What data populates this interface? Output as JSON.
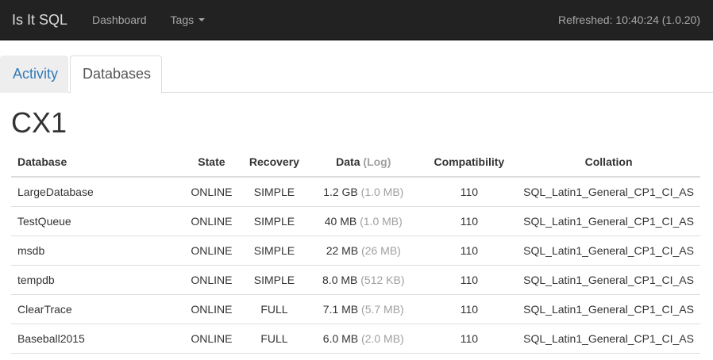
{
  "navbar": {
    "brand": "Is It SQL",
    "links": [
      {
        "label": "Dashboard"
      },
      {
        "label": "Tags"
      }
    ],
    "refreshed": "Refreshed: 10:40:24 (1.0.20)"
  },
  "tabs": [
    {
      "label": "Activity",
      "active": false
    },
    {
      "label": "Databases",
      "active": true
    }
  ],
  "server": {
    "name": "CX1"
  },
  "table": {
    "headers": {
      "database": "Database",
      "state": "State",
      "recovery": "Recovery",
      "data": "Data",
      "log": "(Log)",
      "compatibility": "Compatibility",
      "collation": "Collation"
    },
    "rows": [
      {
        "database": "LargeDatabase",
        "state": "ONLINE",
        "recovery": "SIMPLE",
        "data": "1.2 GB",
        "log": "(1.0 MB)",
        "compatibility": "110",
        "collation": "SQL_Latin1_General_CP1_CI_AS"
      },
      {
        "database": "TestQueue",
        "state": "ONLINE",
        "recovery": "SIMPLE",
        "data": "40 MB",
        "log": "(1.0 MB)",
        "compatibility": "110",
        "collation": "SQL_Latin1_General_CP1_CI_AS"
      },
      {
        "database": "msdb",
        "state": "ONLINE",
        "recovery": "SIMPLE",
        "data": "22 MB",
        "log": "(26 MB)",
        "compatibility": "110",
        "collation": "SQL_Latin1_General_CP1_CI_AS"
      },
      {
        "database": "tempdb",
        "state": "ONLINE",
        "recovery": "SIMPLE",
        "data": "8.0 MB",
        "log": "(512 KB)",
        "compatibility": "110",
        "collation": "SQL_Latin1_General_CP1_CI_AS"
      },
      {
        "database": "ClearTrace",
        "state": "ONLINE",
        "recovery": "FULL",
        "data": "7.1 MB",
        "log": "(5.7 MB)",
        "compatibility": "110",
        "collation": "SQL_Latin1_General_CP1_CI_AS"
      },
      {
        "database": "Baseball2015",
        "state": "ONLINE",
        "recovery": "FULL",
        "data": "6.0 MB",
        "log": "(2.0 MB)",
        "compatibility": "110",
        "collation": "SQL_Latin1_General_CP1_CI_AS"
      }
    ]
  },
  "colors": {
    "navbar_bg": "#222222",
    "link": "#337ab7",
    "muted": "#a0a0a0"
  }
}
